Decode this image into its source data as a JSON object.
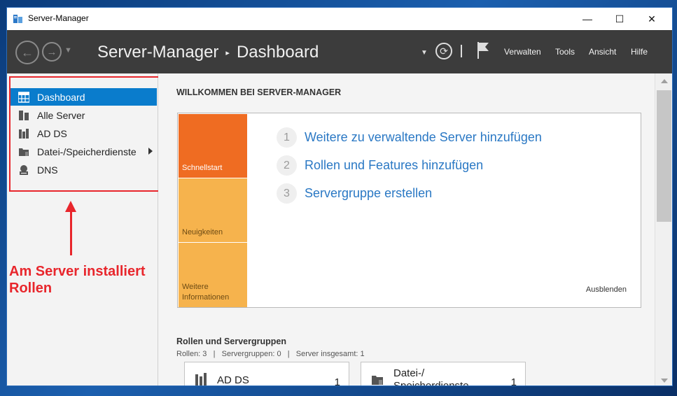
{
  "window": {
    "title": "Server-Manager",
    "minimize": "—",
    "maximize": "☐",
    "close": "✕"
  },
  "header": {
    "breadcrumb": [
      "Server-Manager",
      "Dashboard"
    ],
    "breadcrumb_sep": "▸",
    "menu": [
      "Verwalten",
      "Tools",
      "Ansicht",
      "Hilfe"
    ],
    "icons": [
      "back-arrow-icon",
      "forward-arrow-icon",
      "refresh-icon",
      "flag-icon"
    ]
  },
  "sidebar": {
    "items": [
      {
        "label": "Dashboard",
        "icon": "dashboard-icon",
        "active": true
      },
      {
        "label": "Alle Server",
        "icon": "servers-icon",
        "active": false
      },
      {
        "label": "AD DS",
        "icon": "adds-icon",
        "active": false
      },
      {
        "label": "Datei-/Speicherdienste",
        "icon": "file-storage-icon",
        "active": false,
        "has_submenu": true
      },
      {
        "label": "DNS",
        "icon": "dns-icon",
        "active": false
      }
    ]
  },
  "annotation": {
    "text": "Am Server installiert Rollen",
    "color": "#e8262c"
  },
  "welcome": {
    "title": "WILLKOMMEN BEI SERVER-MANAGER",
    "tiles": [
      "Schnellstart",
      "Neuigkeiten",
      "Weitere Informationen"
    ],
    "steps": [
      {
        "num": "1",
        "text": "Weitere zu verwaltende Server hinzufügen"
      },
      {
        "num": "2",
        "text": "Rollen und Features hinzufügen"
      },
      {
        "num": "3",
        "text": "Servergruppe erstellen"
      }
    ],
    "hide_label": "Ausblenden"
  },
  "roles": {
    "title": "Rollen und Servergruppen",
    "stats": "Rollen: 3   |   Servergruppen: 0   |   Server insgesamt: 1",
    "cards": [
      {
        "name": "AD DS",
        "count": "1"
      },
      {
        "name": "Datei-/ Speicherdienste",
        "count": "1"
      }
    ]
  },
  "colors": {
    "accent": "#0a7ccc",
    "header_bg": "#3c3c3c",
    "tile_orange": "#ef6c22",
    "tile_yellow": "#f6b34d",
    "link": "#2a78c4"
  }
}
